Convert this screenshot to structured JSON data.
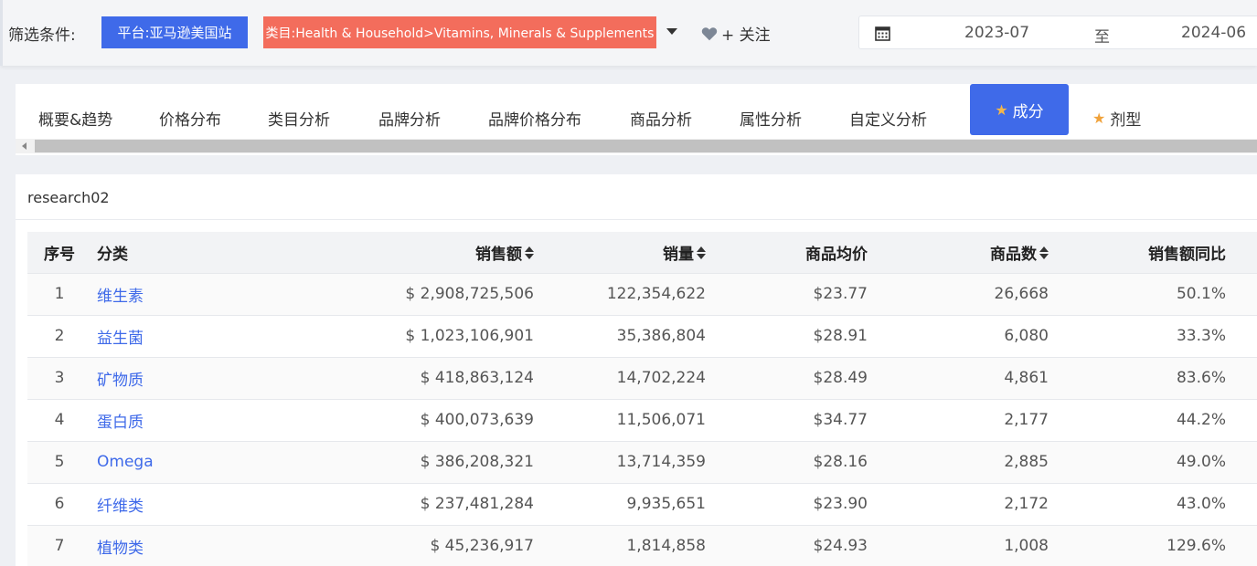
{
  "filter": {
    "label": "筛选条件:",
    "platform": "平台:亚马逊美国站",
    "category": "类目:Health & Household>Vitamins, Minerals & Supplements",
    "follow_label": "+ 关注",
    "date_start": "2023-07",
    "date_separator": "至",
    "date_end": "2024-06"
  },
  "tabs": [
    {
      "label": "概要&趋势"
    },
    {
      "label": "价格分布"
    },
    {
      "label": "类目分析"
    },
    {
      "label": "品牌分析"
    },
    {
      "label": "品牌价格分布"
    },
    {
      "label": "商品分析"
    },
    {
      "label": "属性分析"
    },
    {
      "label": "自定义分析"
    },
    {
      "label": "成分",
      "active": true,
      "starred": true
    },
    {
      "label": "剂型",
      "starred": true
    }
  ],
  "card": {
    "title": "research02"
  },
  "table": {
    "headers": [
      "序号",
      "分类",
      "销售额",
      "销量",
      "商品均价",
      "商品数",
      "销售额同比"
    ],
    "rows": [
      {
        "idx": "1",
        "category": "维生素",
        "sales": "$ 2,908,725,506",
        "volume": "122,354,622",
        "avg_price": "$23.77",
        "count": "26,668",
        "yoy": "50.1%"
      },
      {
        "idx": "2",
        "category": "益生菌",
        "sales": "$ 1,023,106,901",
        "volume": "35,386,804",
        "avg_price": "$28.91",
        "count": "6,080",
        "yoy": "33.3%"
      },
      {
        "idx": "3",
        "category": "矿物质",
        "sales": "$ 418,863,124",
        "volume": "14,702,224",
        "avg_price": "$28.49",
        "count": "4,861",
        "yoy": "83.6%"
      },
      {
        "idx": "4",
        "category": "蛋白质",
        "sales": "$ 400,073,639",
        "volume": "11,506,071",
        "avg_price": "$34.77",
        "count": "2,177",
        "yoy": "44.2%"
      },
      {
        "idx": "5",
        "category": "Omega",
        "sales": "$ 386,208,321",
        "volume": "13,714,359",
        "avg_price": "$28.16",
        "count": "2,885",
        "yoy": "49.0%"
      },
      {
        "idx": "6",
        "category": "纤维类",
        "sales": "$ 237,481,284",
        "volume": "9,935,651",
        "avg_price": "$23.90",
        "count": "2,172",
        "yoy": "43.0%"
      },
      {
        "idx": "7",
        "category": "植物类",
        "sales": "$ 45,236,917",
        "volume": "1,814,858",
        "avg_price": "$24.93",
        "count": "1,008",
        "yoy": "129.6%"
      }
    ]
  },
  "colors": {
    "primary": "#3f6ae9",
    "category_tag": "#f36d5c",
    "star": "#f0a23b"
  }
}
